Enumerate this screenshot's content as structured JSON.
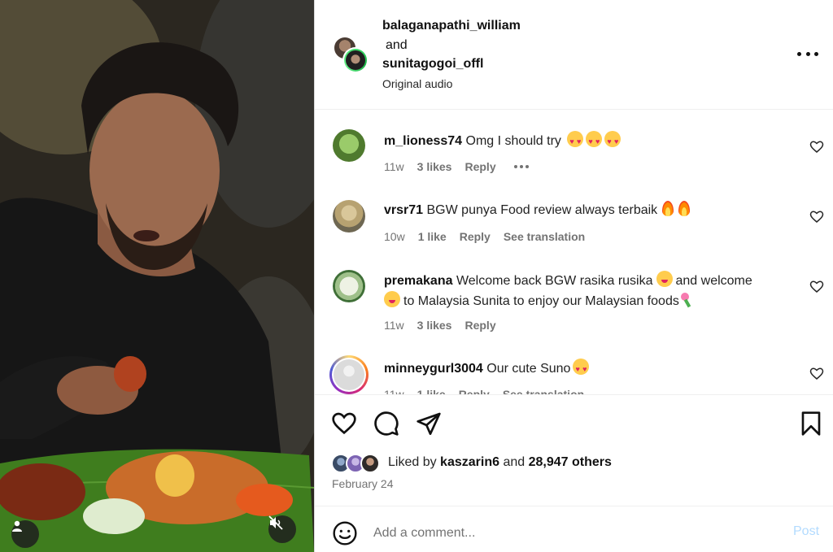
{
  "header": {
    "user1": "balaganapathi_william",
    "conjunction": "and",
    "user2": "sunitagogoi_offl",
    "audio": "Original audio",
    "more_icon": "more-horizontal-icon"
  },
  "comments": [
    {
      "username": "m_lioness74",
      "text": "Omg I should try",
      "time": "11w",
      "likes": "3 likes",
      "reply": "Reply",
      "translation": ""
    },
    {
      "username": "vrsr71",
      "text": "BGW punya Food review always terbaik",
      "time": "10w",
      "likes": "1 like",
      "reply": "Reply",
      "translation": "See translation"
    },
    {
      "username": "premakana",
      "text_part1": "Welcome back BGW rasika rusika",
      "text_part2": "and welcome",
      "text_part3": "to Malaysia Sunita to enjoy our Malaysian foods",
      "time": "11w",
      "likes": "3 likes",
      "reply": "Reply",
      "translation": ""
    },
    {
      "username": "minneygurl3004",
      "text": "Our cute Suno",
      "time": "11w",
      "likes": "1 like",
      "reply": "Reply",
      "translation": "See translation"
    }
  ],
  "actions": {
    "like_icon": "heart-icon",
    "comment_icon": "comment-icon",
    "share_icon": "send-icon",
    "save_icon": "bookmark-icon"
  },
  "likes": {
    "prefix": "Liked by",
    "user": "kaszarin6",
    "middle": "and",
    "count": "28,947 others"
  },
  "date": "February 24",
  "add_comment": {
    "placeholder": "Add a comment...",
    "post_label": "Post",
    "emoji_icon": "smiley-icon"
  },
  "colors": {
    "link_disabled": "#b3dbff",
    "secondary_text": "#737373",
    "divider": "#efefef"
  }
}
